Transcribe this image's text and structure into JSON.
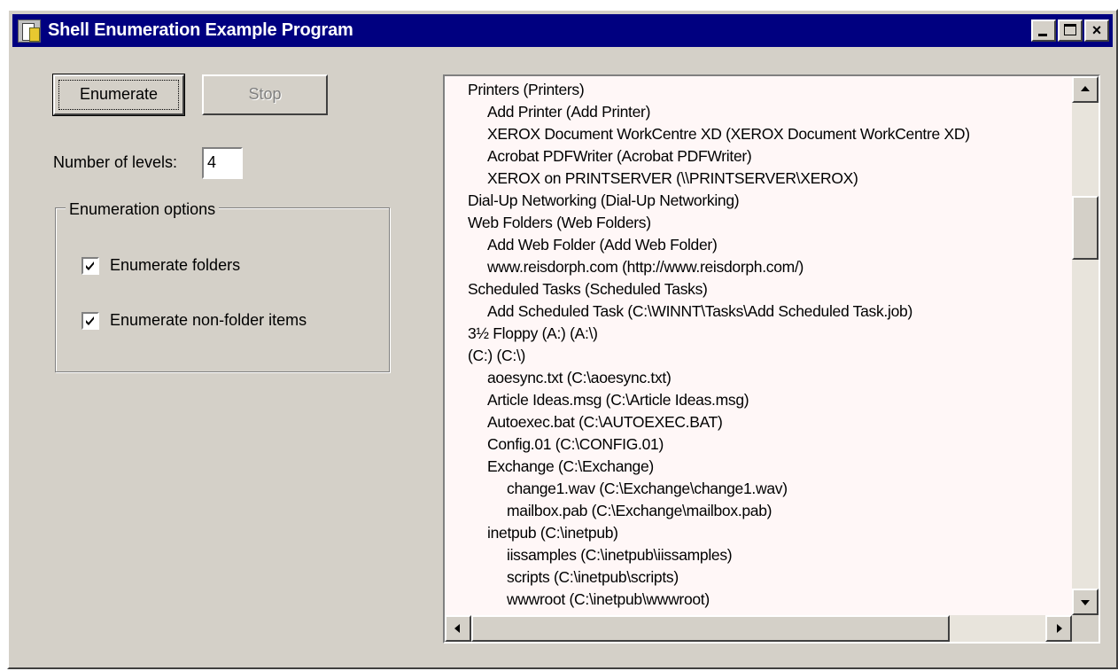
{
  "window": {
    "title": "Shell Enumeration Example Program"
  },
  "titlebar_buttons": {
    "close_glyph": "×"
  },
  "buttons": {
    "enumerate": "Enumerate",
    "stop": "Stop"
  },
  "levels": {
    "label": "Number of levels:",
    "value": "4"
  },
  "options": {
    "legend": "Enumeration options",
    "folders_label": "Enumerate folders",
    "folders_checked": true,
    "nonfolder_label": "Enumerate non-folder items",
    "nonfolder_checked": true
  },
  "list": {
    "items": [
      {
        "text": "Printers (Printers)",
        "level": 0
      },
      {
        "text": "Add Printer (Add Printer)",
        "level": 1
      },
      {
        "text": "XEROX Document WorkCentre XD (XEROX Document WorkCentre XD)",
        "level": 1
      },
      {
        "text": "Acrobat PDFWriter (Acrobat PDFWriter)",
        "level": 1
      },
      {
        "text": "XEROX on PRINTSERVER (\\\\PRINTSERVER\\XEROX)",
        "level": 1
      },
      {
        "text": "Dial-Up Networking (Dial-Up Networking)",
        "level": 0
      },
      {
        "text": "Web Folders (Web Folders)",
        "level": 0
      },
      {
        "text": "Add Web Folder (Add Web Folder)",
        "level": 1
      },
      {
        "text": "www.reisdorph.com (http://www.reisdorph.com/)",
        "level": 1
      },
      {
        "text": "Scheduled Tasks (Scheduled Tasks)",
        "level": 0
      },
      {
        "text": "Add Scheduled Task (C:\\WINNT\\Tasks\\Add Scheduled Task.job)",
        "level": 1
      },
      {
        "text": "3½ Floppy (A:) (A:\\)",
        "level": 0
      },
      {
        "text": " (C:) (C:\\)",
        "level": 0
      },
      {
        "text": "aoesync.txt (C:\\aoesync.txt)",
        "level": 1
      },
      {
        "text": "Article Ideas.msg (C:\\Article Ideas.msg)",
        "level": 1
      },
      {
        "text": "Autoexec.bat (C:\\AUTOEXEC.BAT)",
        "level": 1
      },
      {
        "text": "Config.01 (C:\\CONFIG.01)",
        "level": 1
      },
      {
        "text": "Exchange (C:\\Exchange)",
        "level": 1
      },
      {
        "text": "change1.wav (C:\\Exchange\\change1.wav)",
        "level": 2
      },
      {
        "text": "mailbox.pab (C:\\Exchange\\mailbox.pab)",
        "level": 2
      },
      {
        "text": "inetpub (C:\\inetpub)",
        "level": 1
      },
      {
        "text": "iissamples (C:\\inetpub\\iissamples)",
        "level": 2
      },
      {
        "text": "scripts (C:\\inetpub\\scripts)",
        "level": 2
      },
      {
        "text": "wwwroot (C:\\inetpub\\wwwroot)",
        "level": 2
      }
    ],
    "vertical_scroll_position": 0.22,
    "horizontal_scroll_position": 0.0
  }
}
